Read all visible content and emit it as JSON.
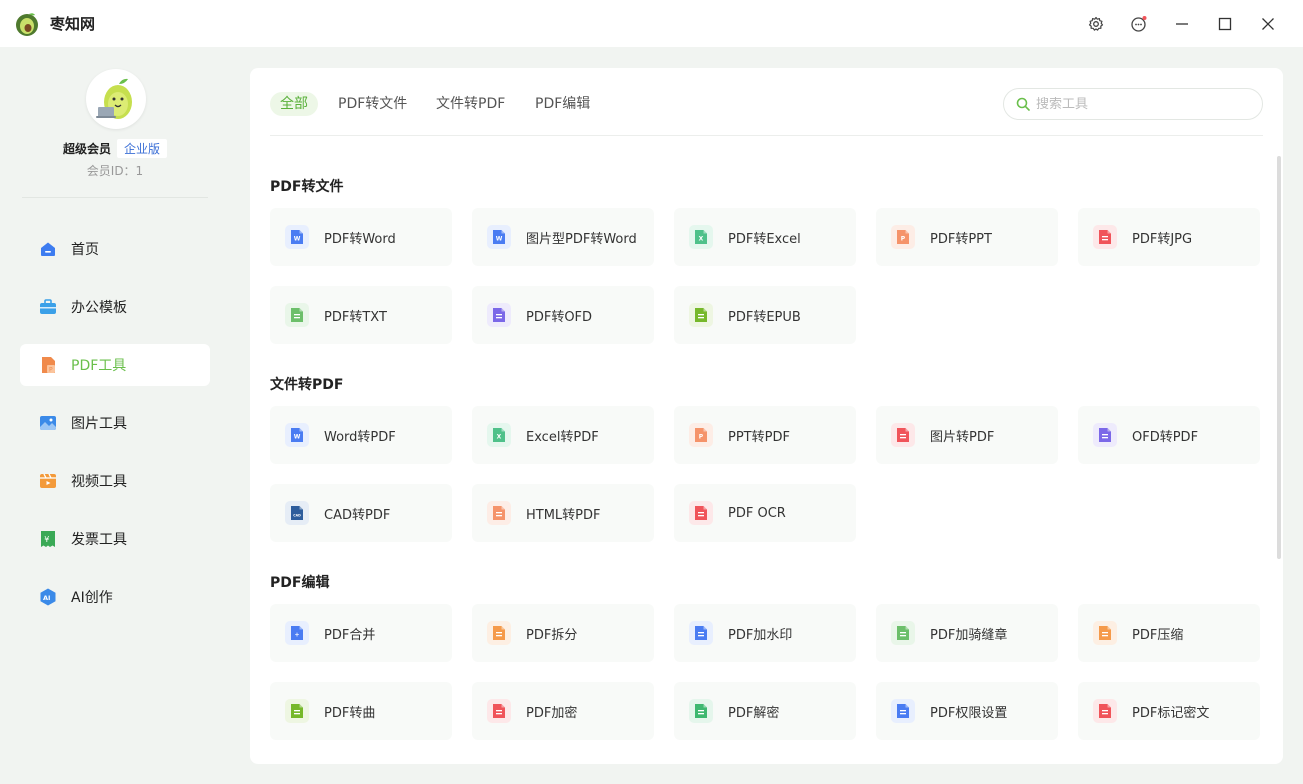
{
  "app": {
    "title": "枣知网"
  },
  "user": {
    "name": "超级会员",
    "tag": "企业版",
    "member_id": "会员ID：1"
  },
  "nav": [
    {
      "label": "首页",
      "icon": "home-icon",
      "color": "#3d7cf0"
    },
    {
      "label": "办公模板",
      "icon": "briefcase-icon",
      "color": "#3ba0e8"
    },
    {
      "label": "PDF工具",
      "icon": "pdf-icon",
      "color": "#f08a4b"
    },
    {
      "label": "图片工具",
      "icon": "image-icon",
      "color": "#3b8ae8"
    },
    {
      "label": "视频工具",
      "icon": "video-icon",
      "color": "#f39a3a"
    },
    {
      "label": "发票工具",
      "icon": "invoice-icon",
      "color": "#3aa956"
    },
    {
      "label": "AI创作",
      "icon": "ai-icon",
      "color": "#3b8ae8"
    }
  ],
  "tabs": [
    "全部",
    "PDF转文件",
    "文件转PDF",
    "PDF编辑"
  ],
  "search": {
    "placeholder": "搜索工具"
  },
  "sections": [
    {
      "title": "PDF转文件",
      "tools": [
        {
          "label": "PDF转Word",
          "icon": "word-icon",
          "color": "#4a7cf2",
          "bg": "#e8effe",
          "glyph": "W"
        },
        {
          "label": "图片型PDF转Word",
          "icon": "word-icon",
          "color": "#4a7cf2",
          "bg": "#e8effe",
          "glyph": "W"
        },
        {
          "label": "PDF转Excel",
          "icon": "excel-icon",
          "color": "#4fc18a",
          "bg": "#e5f7ee",
          "glyph": "X"
        },
        {
          "label": "PDF转PPT",
          "icon": "ppt-icon",
          "color": "#f5936a",
          "bg": "#fdede6",
          "glyph": "P"
        },
        {
          "label": "PDF转JPG",
          "icon": "jpg-icon",
          "color": "#f0545a",
          "bg": "#fde8e9",
          "glyph": ""
        },
        {
          "label": "PDF转TXT",
          "icon": "txt-icon",
          "color": "#6cbf6a",
          "bg": "#e9f6e9",
          "glyph": ""
        },
        {
          "label": "PDF转OFD",
          "icon": "ofd-icon",
          "color": "#7b68e8",
          "bg": "#eeebfc",
          "glyph": ""
        },
        {
          "label": "PDF转EPUB",
          "icon": "epub-icon",
          "color": "#76b82a",
          "bg": "#eef6e2",
          "glyph": ""
        }
      ]
    },
    {
      "title": "文件转PDF",
      "tools": [
        {
          "label": "Word转PDF",
          "icon": "word-icon",
          "color": "#4a7cf2",
          "bg": "#e8effe",
          "glyph": "W"
        },
        {
          "label": "Excel转PDF",
          "icon": "excel-icon",
          "color": "#4fc18a",
          "bg": "#e5f7ee",
          "glyph": "X"
        },
        {
          "label": "PPT转PDF",
          "icon": "ppt-icon",
          "color": "#f5936a",
          "bg": "#fdede6",
          "glyph": "P"
        },
        {
          "label": "图片转PDF",
          "icon": "image-to-pdf-icon",
          "color": "#f0545a",
          "bg": "#fde8e9",
          "glyph": ""
        },
        {
          "label": "OFD转PDF",
          "icon": "ofd-icon",
          "color": "#7b68e8",
          "bg": "#eeebfc",
          "glyph": ""
        },
        {
          "label": "CAD转PDF",
          "icon": "cad-icon",
          "color": "#2d5d9c",
          "bg": "#e6edf6",
          "glyph": "CAD"
        },
        {
          "label": "HTML转PDF",
          "icon": "html-icon",
          "color": "#f5936a",
          "bg": "#fdede6",
          "glyph": ""
        },
        {
          "label": "PDF OCR",
          "icon": "ocr-icon",
          "color": "#f0545a",
          "bg": "#fde8e9",
          "glyph": ""
        }
      ]
    },
    {
      "title": "PDF编辑",
      "tools": [
        {
          "label": "PDF合并",
          "icon": "merge-icon",
          "color": "#4a7cf2",
          "bg": "#e8effe",
          "glyph": "+"
        },
        {
          "label": "PDF拆分",
          "icon": "split-icon",
          "color": "#f59a4a",
          "bg": "#fdefe3",
          "glyph": ""
        },
        {
          "label": "PDF加水印",
          "icon": "watermark-icon",
          "color": "#4a7cf2",
          "bg": "#e8effe",
          "glyph": ""
        },
        {
          "label": "PDF加骑缝章",
          "icon": "seal-icon",
          "color": "#6cbf6a",
          "bg": "#e9f6e9",
          "glyph": ""
        },
        {
          "label": "PDF压缩",
          "icon": "compress-icon",
          "color": "#f59a4a",
          "bg": "#fdefe3",
          "glyph": ""
        },
        {
          "label": "PDF转曲",
          "icon": "curve-icon",
          "color": "#76b82a",
          "bg": "#eef6e2",
          "glyph": ""
        },
        {
          "label": "PDF加密",
          "icon": "encrypt-icon",
          "color": "#f0545a",
          "bg": "#fde8e9",
          "glyph": ""
        },
        {
          "label": "PDF解密",
          "icon": "decrypt-icon",
          "color": "#3fb870",
          "bg": "#e5f6ec",
          "glyph": ""
        },
        {
          "label": "PDF权限设置",
          "icon": "permission-icon",
          "color": "#4a7cf2",
          "bg": "#e8effe",
          "glyph": ""
        },
        {
          "label": "PDF标记密文",
          "icon": "redact-icon",
          "color": "#f0545a",
          "bg": "#fde8e9",
          "glyph": ""
        }
      ]
    }
  ]
}
